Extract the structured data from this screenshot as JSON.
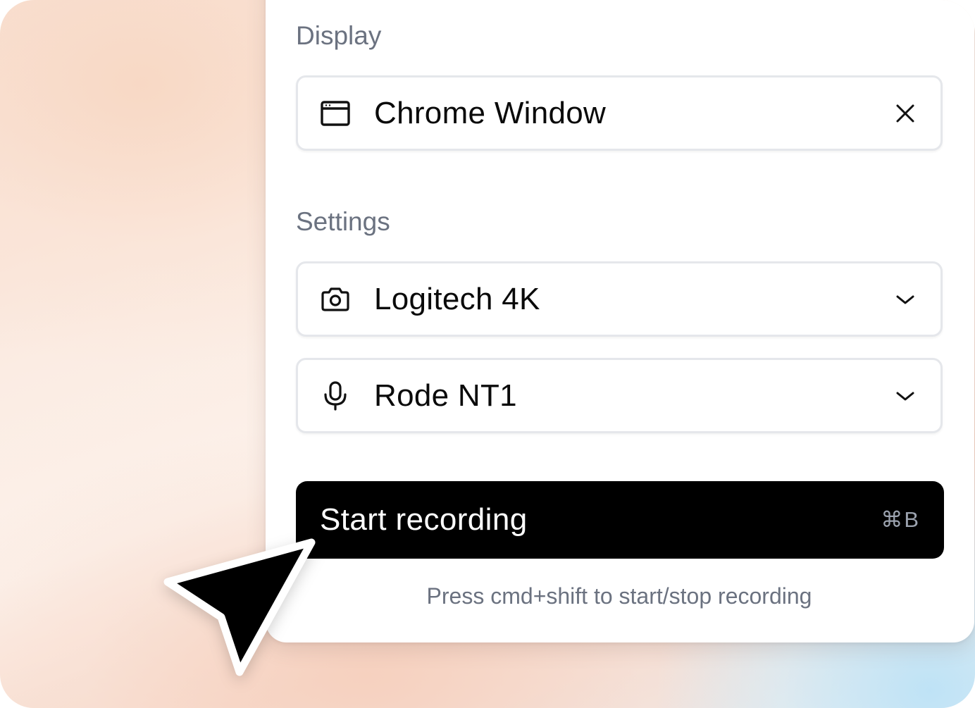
{
  "display": {
    "section_label": "Display",
    "source": {
      "icon": "browser-window-icon",
      "value": "Chrome Window",
      "action_icon": "close-icon"
    }
  },
  "settings": {
    "section_label": "Settings",
    "camera": {
      "icon": "camera-icon",
      "value": "Logitech 4K",
      "action_icon": "chevron-down-icon"
    },
    "microphone": {
      "icon": "microphone-icon",
      "value": "Rode NT1",
      "action_icon": "chevron-down-icon"
    }
  },
  "record_button": {
    "label": "Start recording",
    "shortcut": "⌘B"
  },
  "hint": "Press cmd+shift to start/stop recording",
  "cursor_icon": "arrow-cursor-icon",
  "colors": {
    "primary_button": "#000000",
    "label_gray": "#6b7280",
    "border": "#e5e7eb"
  }
}
